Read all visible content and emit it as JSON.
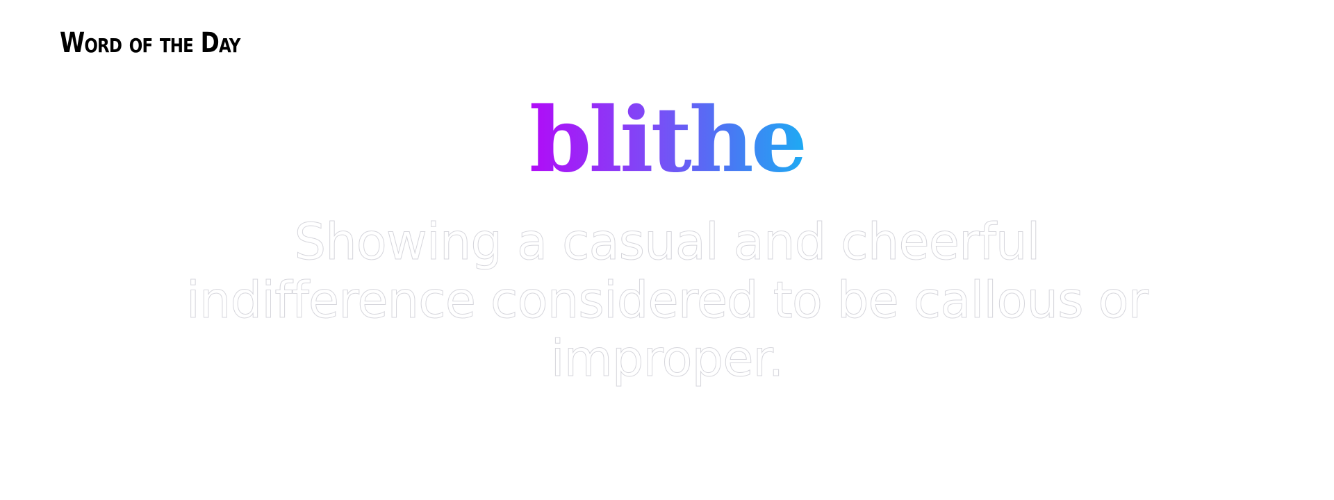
{
  "header": {
    "title": "Word of the Day"
  },
  "word": {
    "text": "blithe"
  },
  "definition": {
    "text": "Showing a casual and cheerful indifference considered to be callous or improper."
  },
  "colors": {
    "gradient_start": "#b10bf7",
    "gradient_end": "#1eaaf3",
    "heading": "#000000",
    "definition_outline": "#d6d6dc"
  }
}
